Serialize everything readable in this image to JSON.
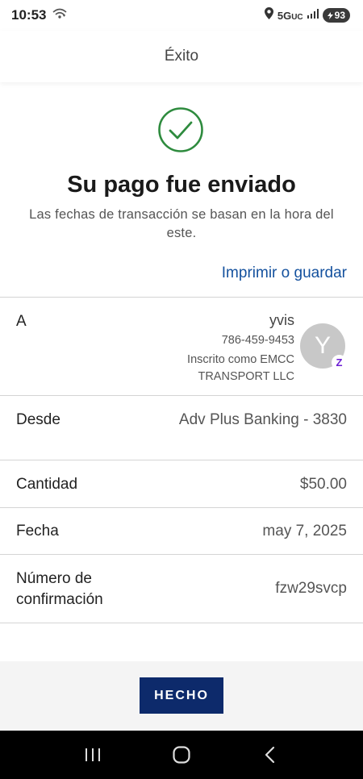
{
  "status_bar": {
    "time": "10:53",
    "network": "5G",
    "network_sub": "UC",
    "battery": "93",
    "icons": [
      "wifi-calling-icon",
      "location-icon",
      "signal-icon",
      "battery-icon"
    ]
  },
  "header": {
    "title": "Éxito"
  },
  "success": {
    "icon": "check-circle-icon",
    "icon_color": "#2e8b3e",
    "headline": "Su pago fue enviado",
    "subtitle": "Las fechas de transacción se basan en la hora del este."
  },
  "print_link": "Imprimir o guardar",
  "recipient": {
    "label": "A",
    "name": "yvis",
    "phone": "786-459-9453",
    "enrolled": "Inscrito como EMCC TRANSPORT LLC",
    "avatar_initial": "Y",
    "badge_icon": "zelle-icon",
    "badge_glyph": "Z"
  },
  "details": [
    {
      "label": "Desde",
      "value": "Adv Plus Banking - 3830"
    },
    {
      "label": "Cantidad",
      "value": "$50.00"
    },
    {
      "label": "Fecha",
      "value": "may 7, 2025"
    },
    {
      "label": "Número de confirmación",
      "value": "fzw29svcp"
    }
  ],
  "footer": {
    "done_label": "HECHO"
  },
  "colors": {
    "accent": "#14519e",
    "button_bg": "#0d2a6b",
    "success_green": "#2e8b3e",
    "zelle_purple": "#6d1ed4"
  },
  "nav": [
    "recent-apps-icon",
    "home-icon",
    "back-icon"
  ]
}
